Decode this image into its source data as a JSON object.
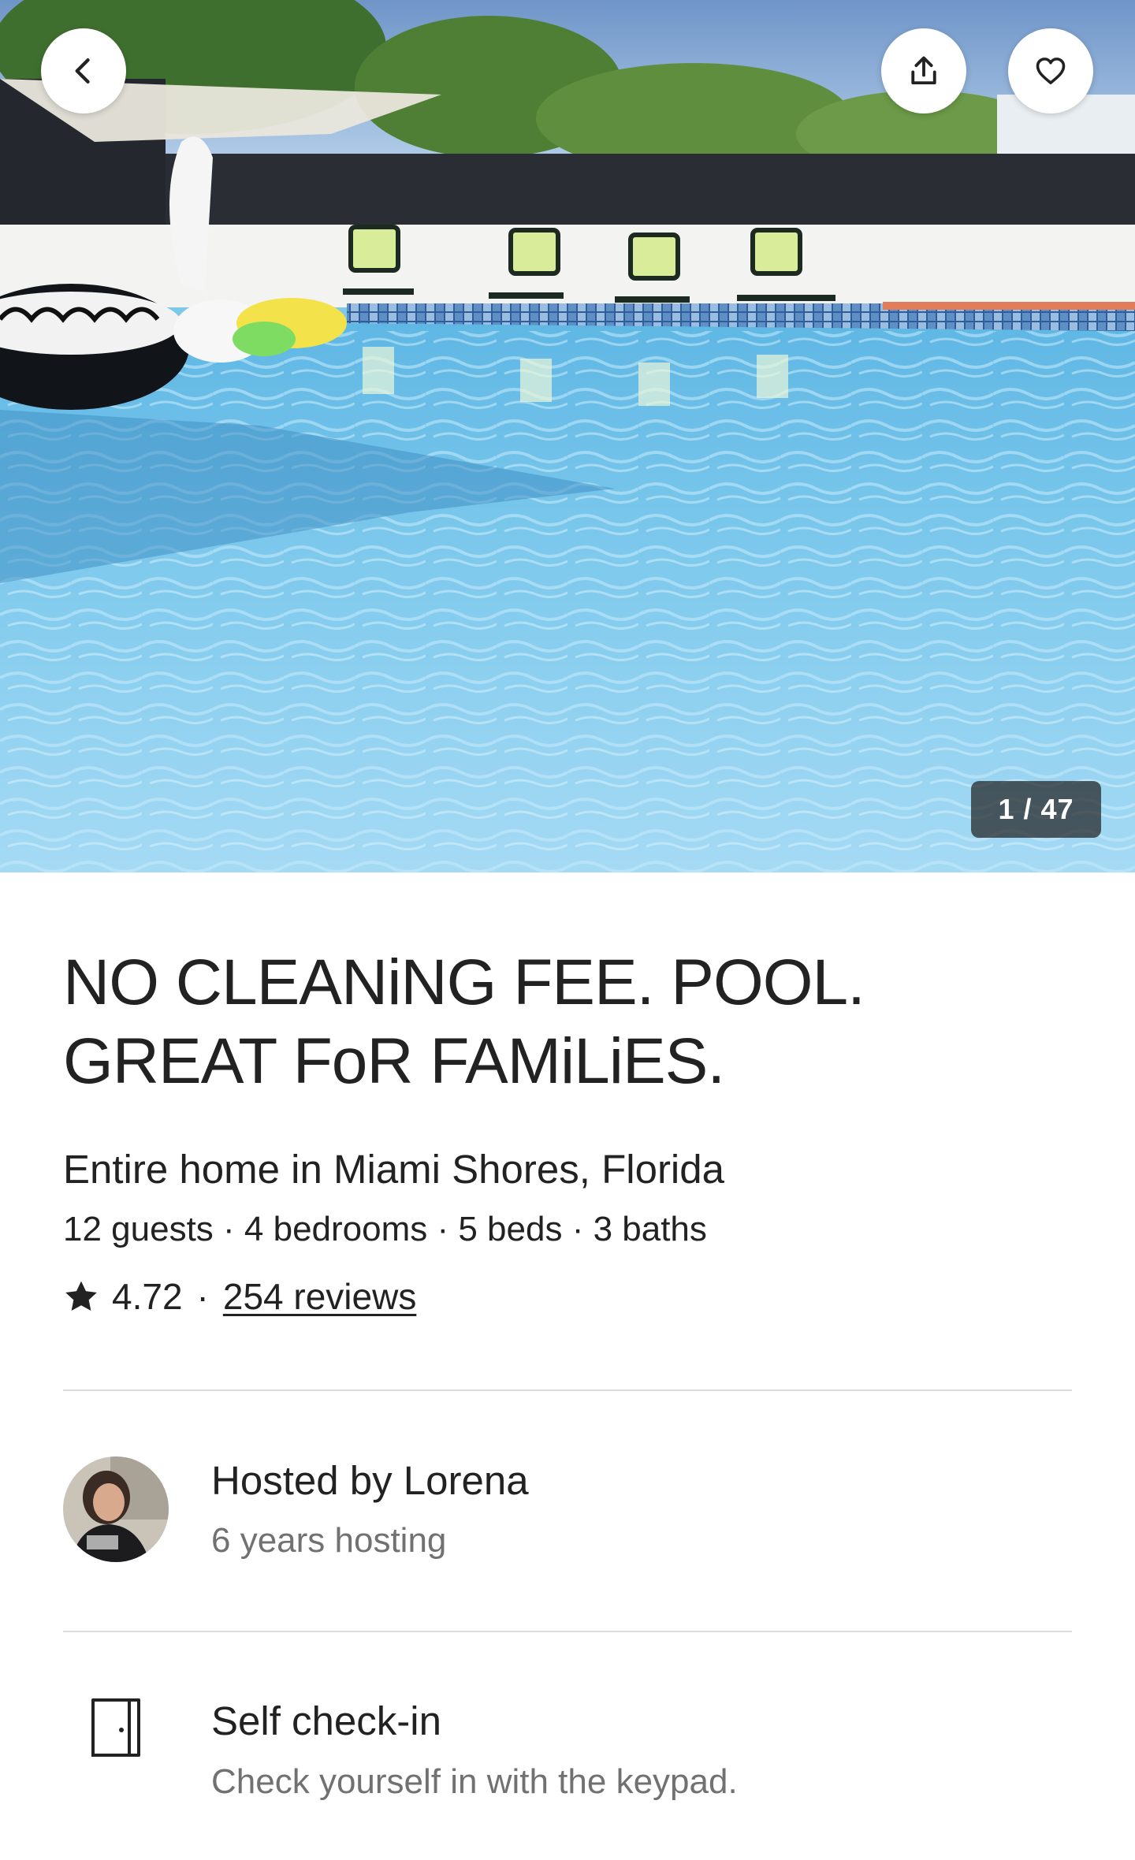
{
  "hero": {
    "photo_description_icon": "pool-photo",
    "photo_counter": "1 / 47",
    "buttons": {
      "back_icon": "chevron-left-icon",
      "share_icon": "share-icon",
      "save_icon": "heart-icon"
    }
  },
  "listing": {
    "title_line1": "NO CLEANiNG FEE. POOL.",
    "title_line2": "GREAT FoR FAMiLiES.",
    "subtitle": "Entire home in Miami Shores, Florida",
    "details": "12 guests · 4 bedrooms · 5 beds · 3 baths",
    "rating": "4.72",
    "rating_separator": "·",
    "reviews_link": "254 reviews"
  },
  "host": {
    "name_line": "Hosted by Lorena",
    "experience": "6 years hosting"
  },
  "highlights": [
    {
      "icon": "door-icon",
      "title": "Self check-in",
      "description": "Check yourself in with the keypad."
    }
  ],
  "colors": {
    "text_primary": "#222222",
    "text_secondary": "#717171",
    "divider": "#dddddd",
    "counter_bg": "#222222"
  }
}
